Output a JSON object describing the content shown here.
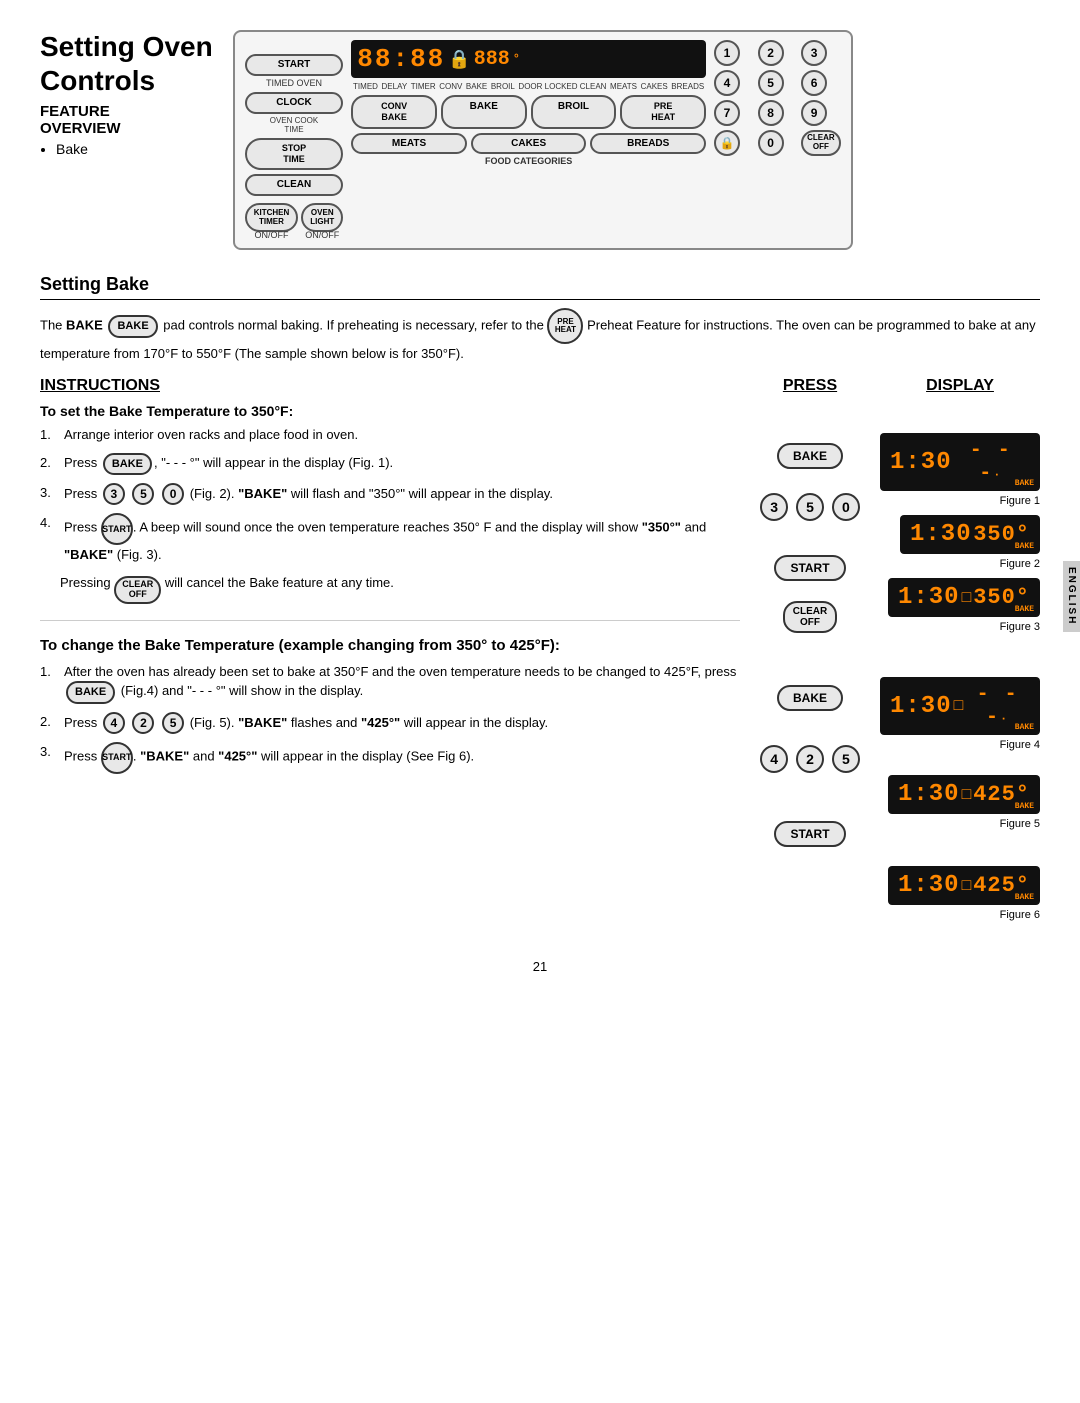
{
  "page": {
    "title_line1": "Setting Oven",
    "title_line2": "Controls",
    "feature_label": "FEATURE",
    "overview_label": "OVERVIEW",
    "bake_bullet": "Bake",
    "page_number": "21",
    "english_tab": "ENGLISH"
  },
  "oven_panel": {
    "start_btn": "START",
    "timed_oven_label": "TIMED OVEN",
    "clock_btn": "CLOCK",
    "oven_cook_time_btn": "OVEN COOK TIME",
    "stop_time_btn": "STOP TIME",
    "clean_btn": "CLEAN",
    "kitchen_timer_btn": "KITCHEN TIMER",
    "kitchen_timer_label": "ON/OFF",
    "oven_light_btn": "OVEN LIGHT",
    "oven_light_label": "ON/OFF",
    "display_time": "88:88",
    "display_temp": "888",
    "display_labels": [
      "TIMED",
      "DELAY",
      "TIMER",
      "CONV",
      "BAKE",
      "BROIL",
      "DOOR LOCKED",
      "CLEAN",
      "MEATS",
      "CAKES",
      "BREADS"
    ],
    "conv_bake_btn": "CONV BAKE",
    "bake_btn": "BAKE",
    "broil_btn": "BROIL",
    "pre_heat_btn": "PRE HEAT",
    "meats_btn": "MEATS",
    "cakes_btn": "CAKES",
    "breads_btn": "BREADS",
    "food_categories_label": "FOOD CATEGORIES",
    "num_buttons": [
      "1",
      "2",
      "3",
      "4",
      "5",
      "6",
      "7",
      "8",
      "9"
    ],
    "lock_btn": "🔒",
    "zero_btn": "0",
    "clear_off_btn": "CLEAR OFF"
  },
  "setting_bake": {
    "section_title": "Setting Bake",
    "intro_part1": "The ",
    "intro_bake_word": "BAKE",
    "intro_part2": " pad controls normal baking. If preheating is necessary, refer to the",
    "intro_preheat": "PRE HEAT",
    "intro_part3": "Preheat Feature for",
    "intro_line2": "instructions. The oven can be programmed to bake at any temperature from 170°F to 550°F (The sample shown below is for 350°F).",
    "col_instructions": "INSTRUCTIONS",
    "col_press": "PRESS",
    "col_display": "DISPLAY",
    "subsection1_title": "To set the Bake Temperature to 350°F:",
    "steps": [
      {
        "num": "1.",
        "text": "Arrange interior oven racks and place food in oven."
      },
      {
        "num": "2.",
        "text": "Press",
        "btn": "BAKE",
        "text2": ", \"- - - °\" will appear in the display (Fig. 1)."
      },
      {
        "num": "3.",
        "text": "Press",
        "btns": [
          "3",
          "5",
          "0"
        ],
        "text2": "(Fig. 2). \"BAKE\" will flash and \"350°\" will appear in the display."
      },
      {
        "num": "4.",
        "text": "Press",
        "btn": "START",
        "text2": ". A beep will sound once the oven temperature reaches 350° F and the display will show \"350°\" and \"BAKE\" (Fig. 3)."
      }
    ],
    "pressing_text": "Pressing",
    "pressing_btn": "CLEAR OFF",
    "pressing_text2": "will cancel the Bake feature at any time.",
    "figures": [
      {
        "label": "Figure 1",
        "time": "1:30",
        "temp": "- - -",
        "badge": "BAKE"
      },
      {
        "label": "Figure 2",
        "time": "1:30",
        "temp": "350°",
        "badge": "BAKE"
      },
      {
        "label": "Figure 3",
        "time": "1:30",
        "temp": "350°",
        "badge": "BAKE",
        "blink": true
      }
    ],
    "subsection2_title": "To change the Bake Temperature (example changing from 350° to 425°F):",
    "steps2": [
      {
        "num": "1.",
        "text": "After the oven has already been set to bake at 350°F and the oven temperature needs to be changed to 425°F, press",
        "btn": "BAKE",
        "text2": "(Fig.4) and \"- - - °\" will show in the display."
      },
      {
        "num": "2.",
        "text": "Press",
        "btns": [
          "4",
          "2",
          "5"
        ],
        "text2": "(Fig. 5). \"BAKE\" flashes and \"425°\" will appear in the display."
      },
      {
        "num": "3.",
        "text": "Press",
        "btn": "START",
        "text2": ". \"BAKE\" and \"425°\" will appear in the display (See Fig 6)."
      }
    ],
    "figures2": [
      {
        "label": "Figure 4",
        "time": "1:30",
        "temp": "- - -",
        "badge": "BAKE"
      },
      {
        "label": "Figure 5",
        "time": "1:30",
        "temp": "425°",
        "badge": "BAKE"
      },
      {
        "label": "Figure 6",
        "time": "1:30",
        "temp": "425°",
        "badge": "BAKE"
      }
    ],
    "press_items": [
      {
        "type": "bake",
        "label": "BAKE"
      },
      {
        "type": "nums",
        "nums": [
          "3",
          "5",
          "0"
        ]
      },
      {
        "type": "start",
        "label": "START"
      },
      {
        "type": "clearoff",
        "label": "CLEAR\nOFF"
      },
      {
        "type": "bake",
        "label": "BAKE"
      },
      {
        "type": "nums",
        "nums": [
          "4",
          "2",
          "5"
        ]
      },
      {
        "type": "start",
        "label": "START"
      }
    ]
  }
}
